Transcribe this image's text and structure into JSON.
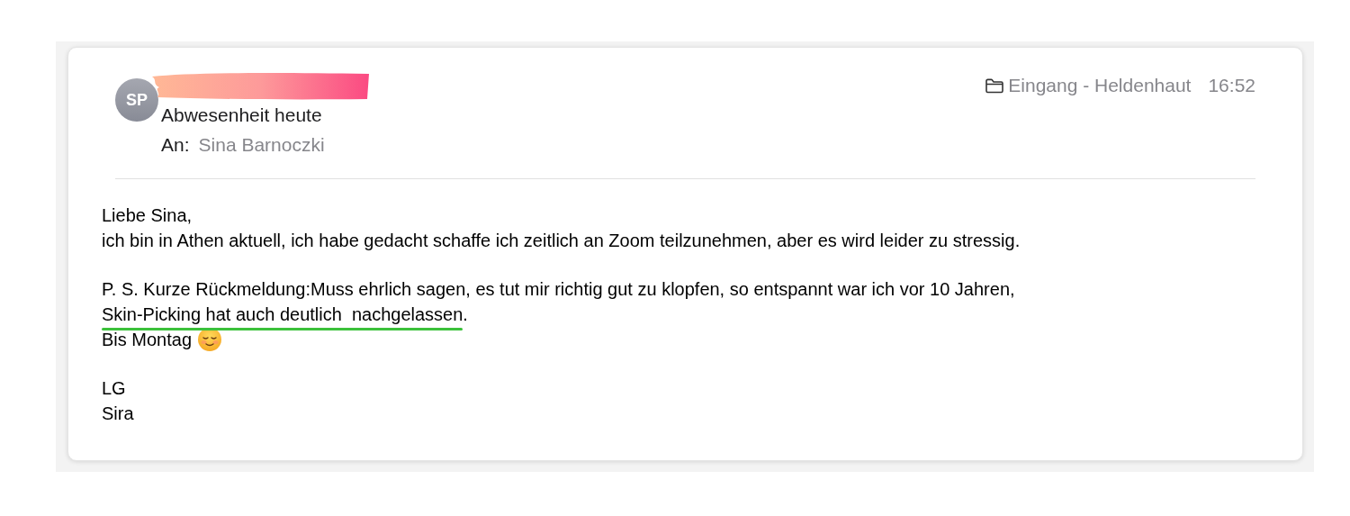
{
  "header": {
    "avatar_initials": "SP",
    "sender_redacted": true,
    "subject": "Abwesenheit heute",
    "to_label": "An:",
    "to_name": "Sina Barnoczki",
    "folder": "Eingang - Heldenhaut",
    "time": "16:52"
  },
  "body": [
    {
      "lines": [
        {
          "text": "Liebe Sina,"
        },
        {
          "text": "ich bin in Athen aktuell, ich habe gedacht schaffe ich zeitlich an Zoom teilzunehmen, aber es wird leider zu stressig."
        }
      ]
    },
    {
      "lines": [
        {
          "text": "P. S. Kurze Rückmeldung:Muss ehrlich sagen, es tut mir richtig gut zu klopfen, so entspannt war ich vor 10 Jahren,"
        },
        {
          "text": "Skin-Picking hat auch deutlich  nachgelassen",
          "underlined": true,
          "trail": "."
        },
        {
          "text": "Bis Montag",
          "smiley": true
        }
      ]
    },
    {
      "lines": [
        {
          "text": "LG"
        },
        {
          "text": "Sira"
        }
      ]
    }
  ]
}
